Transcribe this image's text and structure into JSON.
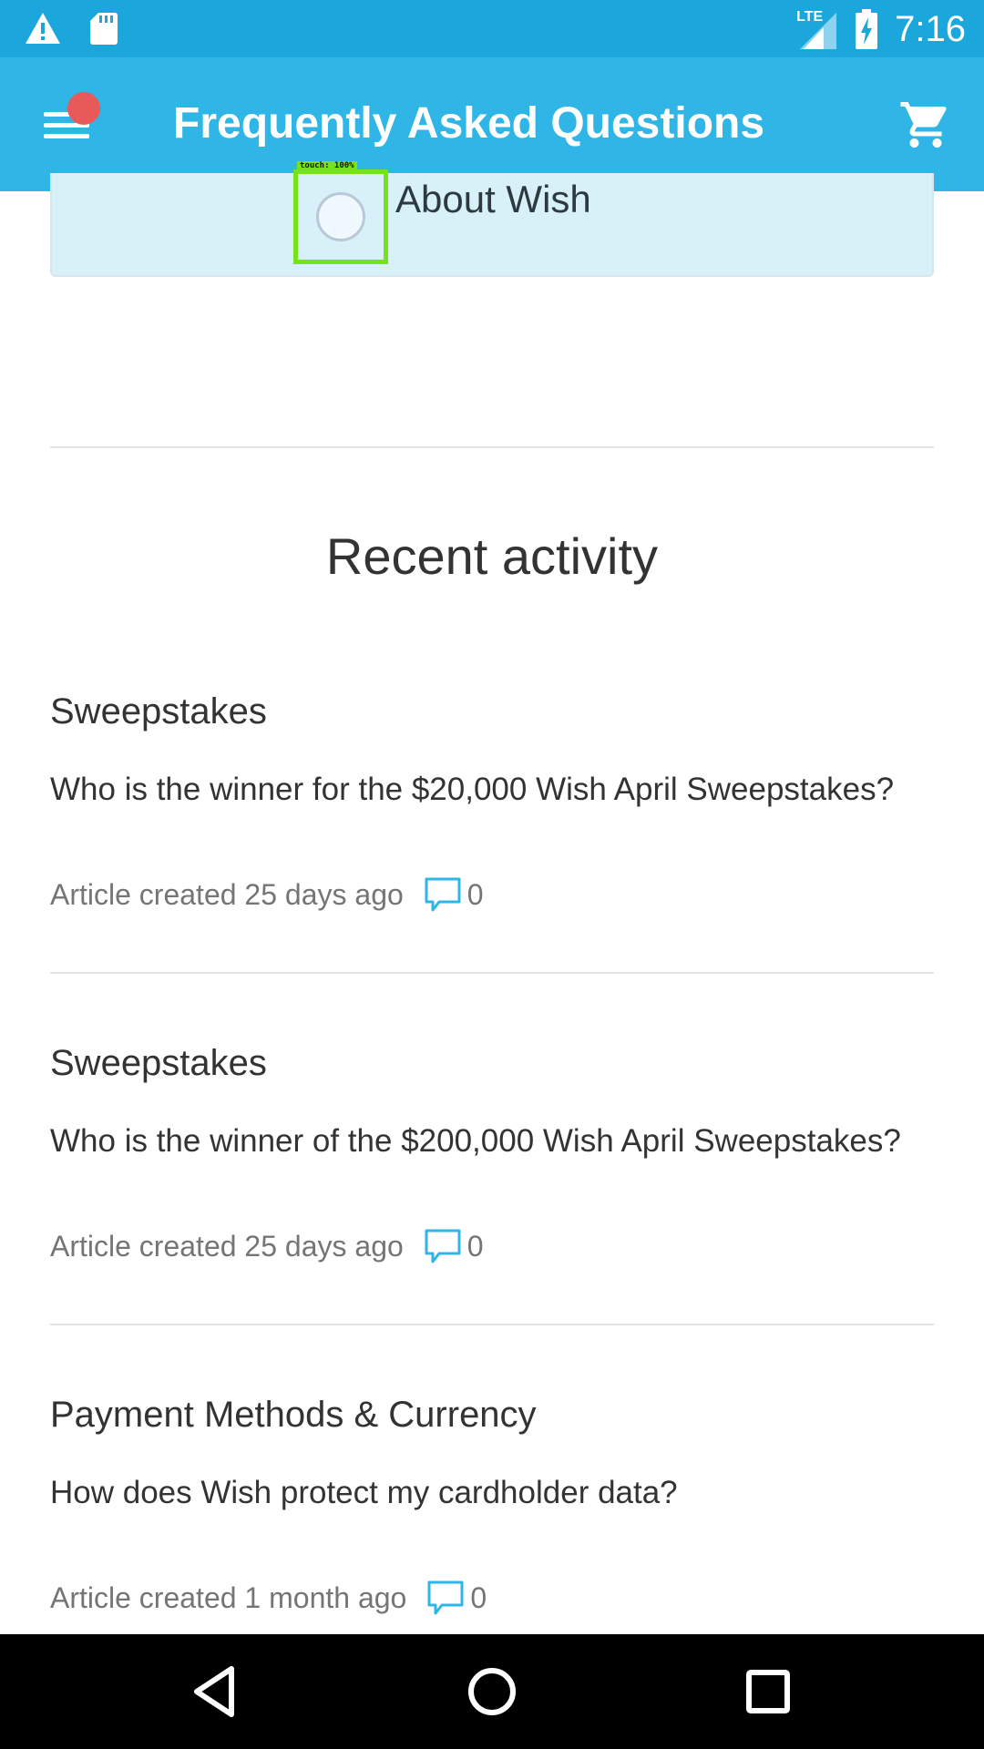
{
  "status_bar": {
    "time": "7:16",
    "network_label": "LTE",
    "icons": [
      "warning-icon",
      "sd-card-icon",
      "signal-icon",
      "battery-charging-icon"
    ]
  },
  "app_bar": {
    "title": "Frequently Asked Questions",
    "icons": [
      "menu-icon",
      "cart-icon"
    ],
    "colors": {
      "status": "#1ba7db",
      "bar": "#2fb5e6",
      "notification": "#e85a5a"
    }
  },
  "category": {
    "label": "About Wish"
  },
  "touch_overlay": {
    "label": "touch: 100%"
  },
  "recent_activity": {
    "title": "Recent activity",
    "items": [
      {
        "category": "Sweepstakes",
        "question": "Who is the winner for the $20,000 Wish April Sweepstakes?",
        "meta": "Article created 25 days ago",
        "comments": "0"
      },
      {
        "category": "Sweepstakes",
        "question": "Who is the winner of the $200,000 Wish April Sweepstakes?",
        "meta": "Article created 25 days ago",
        "comments": "0"
      },
      {
        "category": "Payment Methods & Currency",
        "question": "How does Wish protect my cardholder data?",
        "meta": "Article created 1 month ago",
        "comments": "0"
      }
    ]
  },
  "nav_bar": {
    "icons": [
      "back-icon",
      "home-icon",
      "recents-icon"
    ]
  }
}
